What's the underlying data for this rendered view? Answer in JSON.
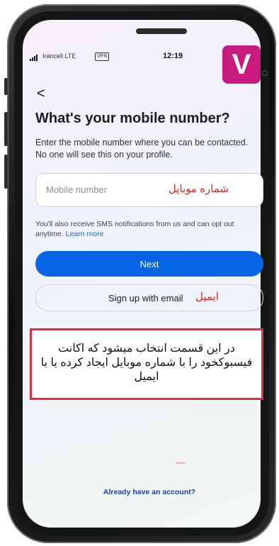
{
  "status_bar": {
    "carrier": "Irancell  LTE",
    "vpn": "VPN",
    "time": "12:19"
  },
  "logo": {
    "letter": "V",
    "color": "#c8197d"
  },
  "nav": {
    "back": "<",
    "back_icon": "chevron-left-icon"
  },
  "screen": {
    "title": "What's your mobile number?",
    "subtitle": "Enter the mobile number where you can be contacted. No one will see this on your profile."
  },
  "mobile_input": {
    "placeholder": "Mobile number",
    "annotation": "شماره موبایل"
  },
  "sms_note": {
    "text": "You'll also receive SMS notifications from us and can opt out anytime.",
    "link": "Learn more"
  },
  "buttons": {
    "next": "Next",
    "email": "Sign up with email",
    "email_annotation": "ایمیل"
  },
  "callout": {
    "text": "در این قسمت انتخاب میشود که اکانت فیسبوکخود را با شماره موبایل ایجاد کرده یا با ایمیل"
  },
  "footer": {
    "already": "Already have an account?"
  },
  "colors": {
    "primary": "#0866e6",
    "annotation": "#e02424",
    "callout_border": "#e52d3a"
  }
}
